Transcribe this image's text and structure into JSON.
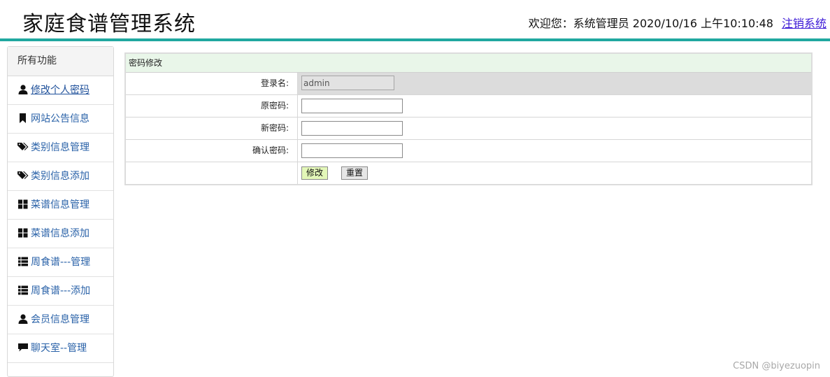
{
  "header": {
    "title": "家庭食谱管理系统",
    "welcome_text": "欢迎您：系统管理员 2020/10/16 上午10:10:48",
    "logout_label": "注销系统"
  },
  "sidebar": {
    "heading": "所有功能",
    "items": [
      {
        "label": "修改个人密码",
        "icon": "user-icon"
      },
      {
        "label": "网站公告信息",
        "icon": "bookmark-icon"
      },
      {
        "label": "类别信息管理",
        "icon": "tags-icon"
      },
      {
        "label": "类别信息添加",
        "icon": "tags-icon"
      },
      {
        "label": "菜谱信息管理",
        "icon": "grid-icon"
      },
      {
        "label": "菜谱信息添加",
        "icon": "grid-icon"
      },
      {
        "label": "周食谱---管理",
        "icon": "list-icon"
      },
      {
        "label": "周食谱---添加",
        "icon": "list-icon"
      },
      {
        "label": "会员信息管理",
        "icon": "user-icon"
      },
      {
        "label": "聊天室--管理",
        "icon": "comment-icon"
      }
    ]
  },
  "form": {
    "title": "密码修改",
    "login_label": "登录名:",
    "login_value": "admin",
    "old_password_label": "原密码:",
    "new_password_label": "新密码:",
    "confirm_password_label": "确认密码:",
    "submit_label": "修改",
    "reset_label": "重置"
  },
  "watermark": "CSDN @biyezuopin",
  "colors": {
    "header_border": "#20a8a0",
    "panel_title_bg": "#e9f6e9",
    "link": "#2a62a8",
    "submit_bg": "#e3f7b8"
  }
}
